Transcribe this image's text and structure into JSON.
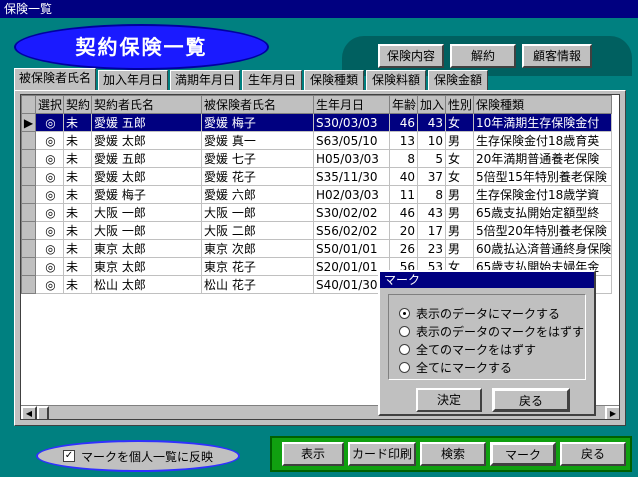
{
  "window": {
    "title": "保険一覧"
  },
  "heading": "契約保険一覧",
  "top_buttons": [
    "保険内容",
    "解約",
    "顧客情報"
  ],
  "tabs": [
    "被保険者氏名",
    "加入年月日",
    "満期年月日",
    "生年月日",
    "保険種類",
    "保険料額",
    "保険金額"
  ],
  "active_tab": "被保険者氏名",
  "table": {
    "columns": [
      "選択",
      "契約",
      "契約者氏名",
      "被保険者氏名",
      "生年月日",
      "年齢",
      "加入",
      "性別",
      "保険種類"
    ],
    "rows": [
      [
        "◎",
        "未",
        "愛媛 五郎",
        "愛媛 梅子",
        "S30/03/03",
        "46",
        "43",
        "女",
        "10年満期生存保険金付"
      ],
      [
        "◎",
        "未",
        "愛媛 太郎",
        "愛媛 真一",
        "S63/05/10",
        "13",
        "10",
        "男",
        "生存保険金付18歳育英"
      ],
      [
        "◎",
        "未",
        "愛媛 五郎",
        "愛媛 七子",
        "H05/03/03",
        "8",
        "5",
        "女",
        "20年満期普通養老保険"
      ],
      [
        "◎",
        "未",
        "愛媛 太郎",
        "愛媛 花子",
        "S35/11/30",
        "40",
        "37",
        "女",
        "5倍型15年特別養老保険"
      ],
      [
        "◎",
        "未",
        "愛媛 梅子",
        "愛媛 六郎",
        "H02/03/03",
        "11",
        "8",
        "男",
        "生存保険金付18歳学資"
      ],
      [
        "◎",
        "未",
        "大阪 一郎",
        "大阪 一郎",
        "S30/02/02",
        "46",
        "43",
        "男",
        "65歳支払開始定額型終"
      ],
      [
        "◎",
        "未",
        "大阪 一郎",
        "大阪 二郎",
        "S56/02/02",
        "20",
        "17",
        "男",
        "5倍型20年特別養老保険"
      ],
      [
        "◎",
        "未",
        "東京 太郎",
        "東京 次郎",
        "S50/01/01",
        "26",
        "23",
        "男",
        "60歳払込済普通終身保険"
      ],
      [
        "◎",
        "未",
        "東京 太郎",
        "東京 花子",
        "S20/01/01",
        "56",
        "53",
        "女",
        "65歳支払開始夫婦年金"
      ],
      [
        "◎",
        "未",
        "松山 太郎",
        "松山 花子",
        "S40/01/30",
        "",
        "",
        "",
        ""
      ]
    ]
  },
  "mark_dialog": {
    "title": "マーク",
    "options": [
      "表示のデータにマークする",
      "表示のデータのマークをはずす",
      "全てのマークをはずす",
      "全てにマークする"
    ],
    "selected_index": 0,
    "ok_label": "決定",
    "back_label": "戻る"
  },
  "checkbox": {
    "label": "マークを個人一覧に反映",
    "checked": true
  },
  "bottom_buttons": [
    "表示",
    "カード印刷",
    "検索",
    "マーク",
    "戻る"
  ]
}
